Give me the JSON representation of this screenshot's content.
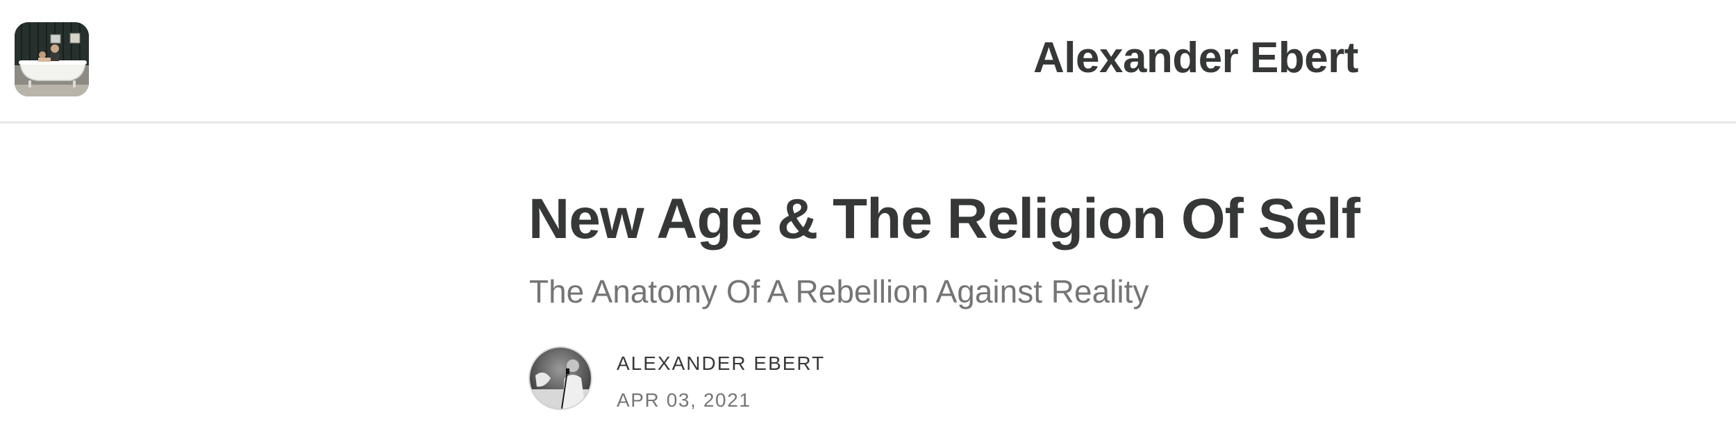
{
  "publication": {
    "name": "Alexander Ebert",
    "logo_icon": "bathtub-photo-logo"
  },
  "post": {
    "title": "New Age & The Religion Of Self",
    "subtitle": "The Anatomy Of A Rebellion Against Reality",
    "author": "ALEXANDER EBERT",
    "date": "APR 03, 2021",
    "author_avatar_icon": "author-photo-avatar"
  },
  "colors": {
    "text_primary": "#363737",
    "text_secondary": "#757575",
    "divider": "#e6e6e6",
    "background": "#ffffff"
  }
}
